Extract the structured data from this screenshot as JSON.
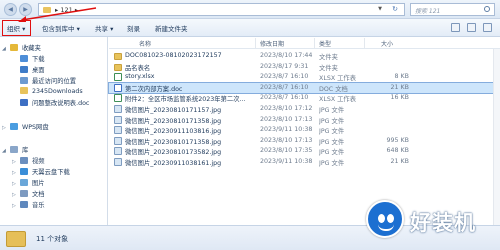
{
  "address_bar": {
    "path_sep": "▸",
    "path": "121",
    "path_trail": "▸",
    "search_placeholder": "搜索 121"
  },
  "toolbar": {
    "organize": "组织 ▾",
    "include_in_library": "包含到库中 ▾",
    "share": "共享 ▾",
    "burn": "刻录",
    "new_folder": "新建文件夹"
  },
  "nav_pane": {
    "items": [
      {
        "label": "收藏夹",
        "icon": "star-icon",
        "level": 0,
        "expand": "◢"
      },
      {
        "label": "下载",
        "icon": "download-folder-icon",
        "level": 1
      },
      {
        "label": "桌面",
        "icon": "desktop-icon",
        "level": 1
      },
      {
        "label": "最近访问的位置",
        "icon": "recent-places-icon",
        "level": 1
      },
      {
        "label": "2345Downloads",
        "icon": "folder-icon",
        "level": 1
      },
      {
        "label": "问题整改说明表.doc",
        "icon": "doc-icon",
        "level": 1
      },
      {
        "label": "WPS网盘",
        "icon": "cloud-icon",
        "level": 0,
        "expand": "▷"
      },
      {
        "label": "库",
        "icon": "library-icon",
        "level": 0,
        "expand": "◢"
      },
      {
        "label": "视频",
        "icon": "video-library-icon",
        "level": 1,
        "expand": "▷"
      },
      {
        "label": "天翼云盘下载",
        "icon": "cloud-download-icon",
        "level": 1,
        "expand": "▷"
      },
      {
        "label": "图片",
        "icon": "picture-library-icon",
        "level": 1,
        "expand": "▷"
      },
      {
        "label": "文档",
        "icon": "document-library-icon",
        "level": 1,
        "expand": "▷"
      },
      {
        "label": "音乐",
        "icon": "music-library-icon",
        "level": 1,
        "expand": "▷"
      }
    ]
  },
  "columns": {
    "name": "名称",
    "date": "修改日期",
    "type": "类型",
    "size": "大小"
  },
  "files": [
    {
      "name": "DOC081023-08102023172157",
      "date": "2023/8/10 17:44",
      "type": "文件夹",
      "size": "",
      "kind": "folder",
      "icon": "folder-icon"
    },
    {
      "name": "品名表名",
      "date": "2023/8/17 9:31",
      "type": "文件夹",
      "size": "",
      "kind": "folder",
      "icon": "folder-icon"
    },
    {
      "name": "story.xlsx",
      "date": "2023/8/7 16:10",
      "type": "XLSX 工作表",
      "size": "8 KB",
      "kind": "xlsx",
      "icon": "xlsx-file-icon"
    },
    {
      "name": "第二次内部方案.doc",
      "date": "2023/8/7 16:10",
      "type": "DOC 文档",
      "size": "21 KB",
      "kind": "doc",
      "icon": "doc-file-icon",
      "selected": true
    },
    {
      "name": "附件2：全区市场监管系统2023年第二次...",
      "date": "2023/8/7 16:10",
      "type": "XLSX 工作表",
      "size": "16 KB",
      "kind": "xlsx",
      "icon": "xlsx-file-icon"
    },
    {
      "name": "微信图片_20230810171157.jpg",
      "date": "2023/8/10 17:12",
      "type": "JPG 文件",
      "size": "",
      "kind": "jpg",
      "icon": "image-file-icon"
    },
    {
      "name": "微信图片_20230810171358.jpg",
      "date": "2023/8/10 17:13",
      "type": "JPG 文件",
      "size": "",
      "kind": "jpg",
      "icon": "image-file-icon"
    },
    {
      "name": "微信图片_20230911103816.jpg",
      "date": "2023/9/11 10:38",
      "type": "JPG 文件",
      "size": "",
      "kind": "jpg",
      "icon": "image-file-icon"
    },
    {
      "name": "微信图片_20230810171358.jpg",
      "date": "2023/8/10 17:13",
      "type": "JPG 文件",
      "size": "995 KB",
      "kind": "jpg",
      "icon": "image-file-icon"
    },
    {
      "name": "微信图片_20230810173582.jpg",
      "date": "2023/8/10 17:35",
      "type": "JPG 文件",
      "size": "648 KB",
      "kind": "jpg",
      "icon": "image-file-icon"
    },
    {
      "name": "微信图片_20230911038161.jpg",
      "date": "2023/9/11 10:38",
      "type": "JPG 文件",
      "size": "21 KB",
      "kind": "jpg",
      "icon": "image-file-icon"
    }
  ],
  "status": {
    "count": "11 个对象"
  },
  "watermark": {
    "text": "好装机"
  },
  "colors": {
    "selection": "#cde5fb",
    "highlight_box": "#e01010",
    "folder": "#e8c35b"
  }
}
